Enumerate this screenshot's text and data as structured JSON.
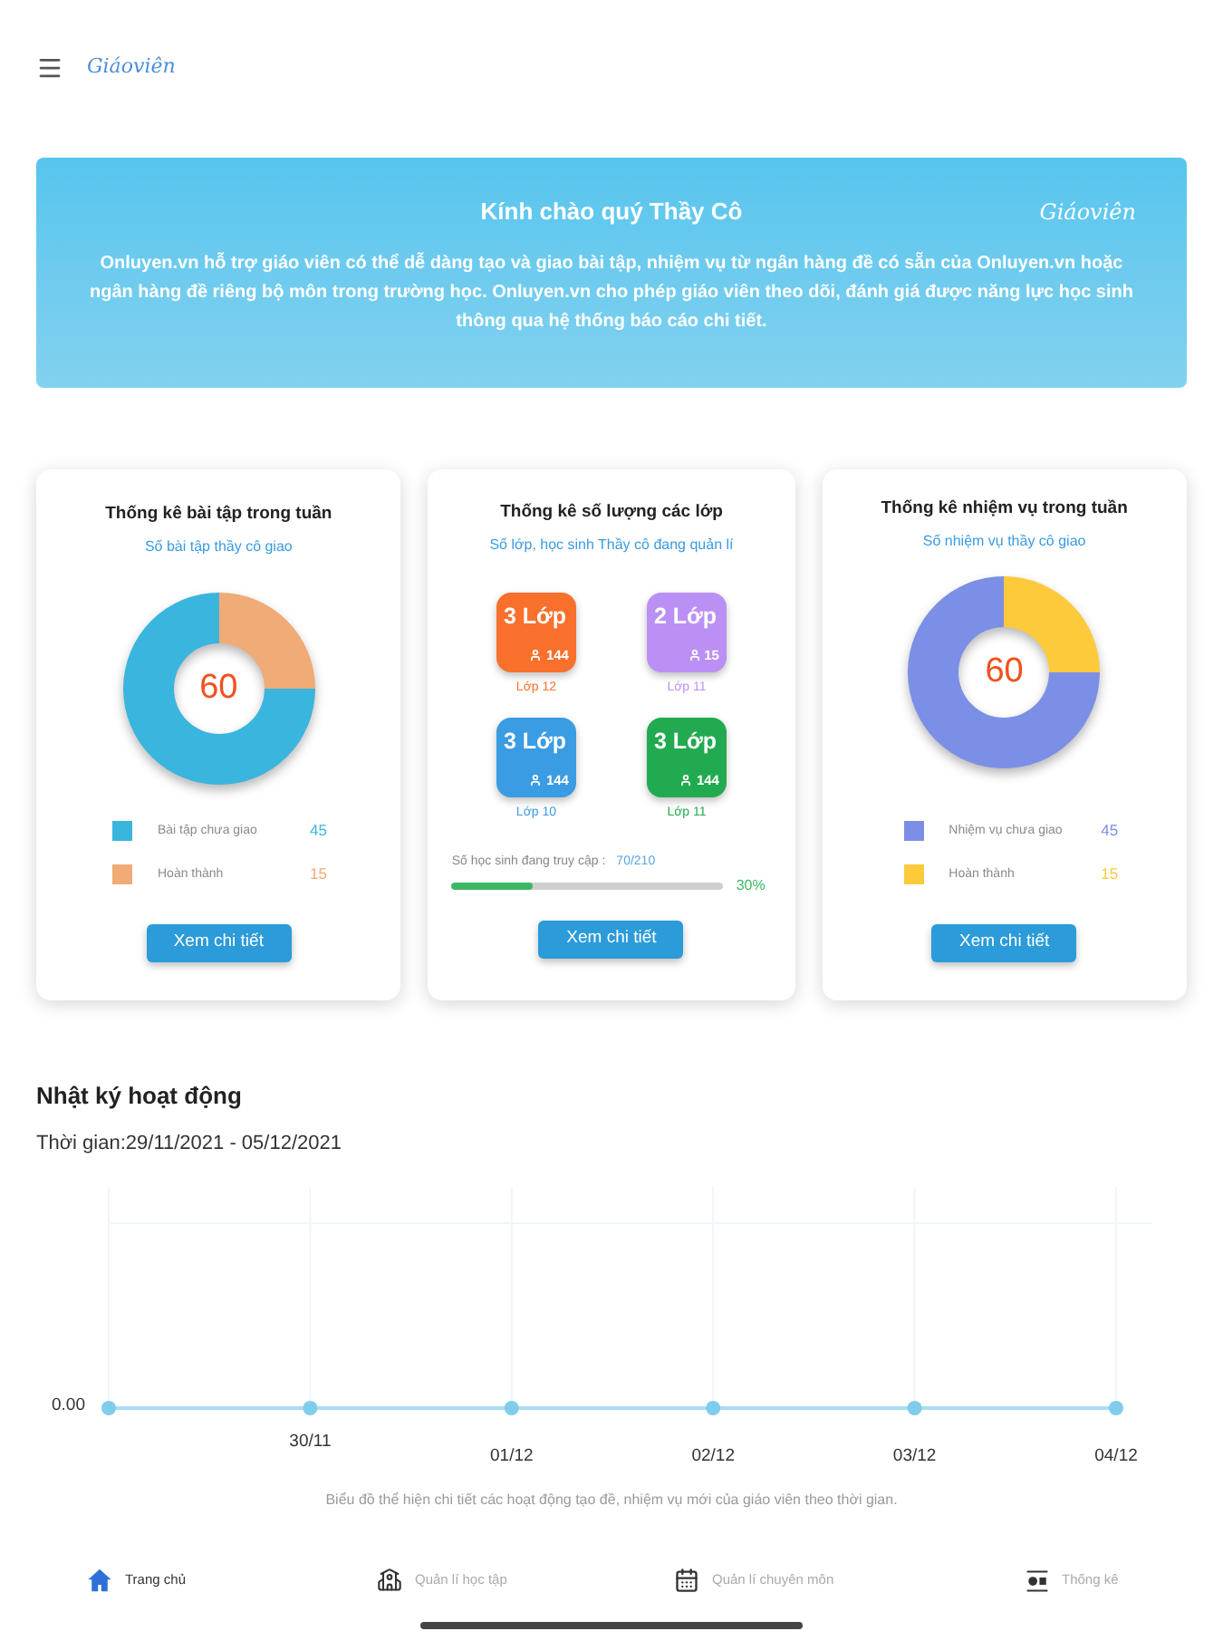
{
  "header": {
    "logo": "Giáoviên"
  },
  "banner": {
    "title": "Kính chào quý Thầy Cô",
    "logo": "Giáoviên",
    "text": "Onluyen.vn hỗ trợ giáo viên có thể dễ dàng tạo và giao bài tập, nhiệm vụ từ ngân hàng đề có sẵn của Onluyen.vn hoặc ngân hàng đề riêng bộ môn trong trường học. Onluyen.vn cho phép giáo viên theo dõi, đánh giá được năng lực học sinh thông qua hệ thống báo cáo chi tiết."
  },
  "cards": [
    {
      "kind": "donut",
      "title": "Thống kê bài tập trong tuần",
      "subtitle": "Số bài tập thầy cô giao",
      "total": "60",
      "chart_data": {
        "type": "donut",
        "values": [
          75,
          25
        ]
      },
      "legend": [
        {
          "label": "Bài tập chưa giao",
          "value": "45",
          "color": "#3ab5de"
        },
        {
          "label": "Hoàn thành",
          "value": "15",
          "color": "#f0ab76"
        }
      ],
      "button": "Xem chi tiết"
    },
    {
      "kind": "classes",
      "title": "Thống kê số lượng các lớp",
      "subtitle": "Số lớp, học sinh Thầy cô đang quản lí",
      "classes": [
        {
          "count": "3 Lớp",
          "students": "144",
          "label": "Lớp 12",
          "color": "#f8702c"
        },
        {
          "count": "2 Lớp",
          "students": "15",
          "label": "Lớp 11",
          "color": "#bb90f4"
        },
        {
          "count": "3 Lớp",
          "students": "144",
          "label": "Lớp 10",
          "color": "#3a9ce2"
        },
        {
          "count": "3 Lớp",
          "students": "144",
          "label": "Lớp 11",
          "color": "#22aa50"
        }
      ],
      "access": {
        "label": "Số học sinh đang truy cập :",
        "value": "70/210",
        "level": 0.3,
        "percent": "30%"
      },
      "button": "Xem chi tiết"
    },
    {
      "kind": "donut",
      "title": "Thống kê nhiệm vụ trong tuần",
      "subtitle": "Số nhiệm vụ thầy cô giao",
      "total": "60",
      "chart_data": {
        "type": "donut",
        "values": [
          75,
          25
        ]
      },
      "legend": [
        {
          "label": "Nhiệm vụ chưa giao",
          "value": "45",
          "color": "#7b8fe6"
        },
        {
          "label": "Hoàn thành",
          "value": "15",
          "color": "#fdca3c"
        }
      ],
      "button": "Xem chi tiết"
    }
  ],
  "activity": {
    "title": "Nhật ký hoạt động",
    "period": "Thời gian:29/11/2021 - 05/12/2021",
    "chart": {
      "y_tick": "0.00",
      "x_ticks": [
        "30/11",
        "01/12",
        "02/12",
        "03/12",
        "04/12"
      ]
    },
    "caption": "Biểu đồ thể hiện chi tiết các hoạt động tạo đề, nhiệm vụ mới của giáo viên theo thời gian."
  },
  "bottom_nav": [
    {
      "label": "Trang chủ",
      "selected": true
    },
    {
      "label": "Quản lí học tập",
      "selected": false
    },
    {
      "label": "Quản lí chuyên môn",
      "selected": false
    },
    {
      "label": "Thống kê",
      "selected": false
    }
  ]
}
